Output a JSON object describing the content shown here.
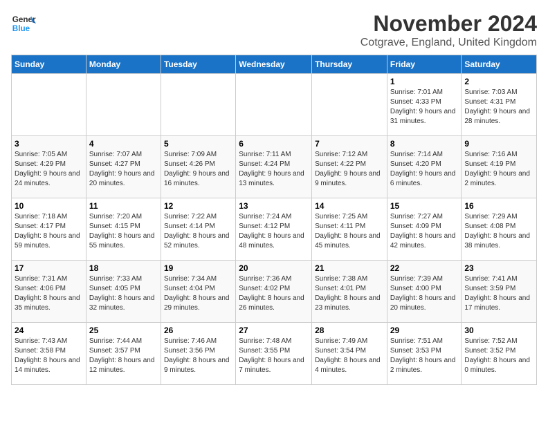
{
  "header": {
    "logo_line1": "General",
    "logo_line2": "Blue",
    "month": "November 2024",
    "location": "Cotgrave, England, United Kingdom"
  },
  "columns": [
    "Sunday",
    "Monday",
    "Tuesday",
    "Wednesday",
    "Thursday",
    "Friday",
    "Saturday"
  ],
  "weeks": [
    [
      {
        "day": "",
        "detail": ""
      },
      {
        "day": "",
        "detail": ""
      },
      {
        "day": "",
        "detail": ""
      },
      {
        "day": "",
        "detail": ""
      },
      {
        "day": "",
        "detail": ""
      },
      {
        "day": "1",
        "detail": "Sunrise: 7:01 AM\nSunset: 4:33 PM\nDaylight: 9 hours and 31 minutes."
      },
      {
        "day": "2",
        "detail": "Sunrise: 7:03 AM\nSunset: 4:31 PM\nDaylight: 9 hours and 28 minutes."
      }
    ],
    [
      {
        "day": "3",
        "detail": "Sunrise: 7:05 AM\nSunset: 4:29 PM\nDaylight: 9 hours and 24 minutes."
      },
      {
        "day": "4",
        "detail": "Sunrise: 7:07 AM\nSunset: 4:27 PM\nDaylight: 9 hours and 20 minutes."
      },
      {
        "day": "5",
        "detail": "Sunrise: 7:09 AM\nSunset: 4:26 PM\nDaylight: 9 hours and 16 minutes."
      },
      {
        "day": "6",
        "detail": "Sunrise: 7:11 AM\nSunset: 4:24 PM\nDaylight: 9 hours and 13 minutes."
      },
      {
        "day": "7",
        "detail": "Sunrise: 7:12 AM\nSunset: 4:22 PM\nDaylight: 9 hours and 9 minutes."
      },
      {
        "day": "8",
        "detail": "Sunrise: 7:14 AM\nSunset: 4:20 PM\nDaylight: 9 hours and 6 minutes."
      },
      {
        "day": "9",
        "detail": "Sunrise: 7:16 AM\nSunset: 4:19 PM\nDaylight: 9 hours and 2 minutes."
      }
    ],
    [
      {
        "day": "10",
        "detail": "Sunrise: 7:18 AM\nSunset: 4:17 PM\nDaylight: 8 hours and 59 minutes."
      },
      {
        "day": "11",
        "detail": "Sunrise: 7:20 AM\nSunset: 4:15 PM\nDaylight: 8 hours and 55 minutes."
      },
      {
        "day": "12",
        "detail": "Sunrise: 7:22 AM\nSunset: 4:14 PM\nDaylight: 8 hours and 52 minutes."
      },
      {
        "day": "13",
        "detail": "Sunrise: 7:24 AM\nSunset: 4:12 PM\nDaylight: 8 hours and 48 minutes."
      },
      {
        "day": "14",
        "detail": "Sunrise: 7:25 AM\nSunset: 4:11 PM\nDaylight: 8 hours and 45 minutes."
      },
      {
        "day": "15",
        "detail": "Sunrise: 7:27 AM\nSunset: 4:09 PM\nDaylight: 8 hours and 42 minutes."
      },
      {
        "day": "16",
        "detail": "Sunrise: 7:29 AM\nSunset: 4:08 PM\nDaylight: 8 hours and 38 minutes."
      }
    ],
    [
      {
        "day": "17",
        "detail": "Sunrise: 7:31 AM\nSunset: 4:06 PM\nDaylight: 8 hours and 35 minutes."
      },
      {
        "day": "18",
        "detail": "Sunrise: 7:33 AM\nSunset: 4:05 PM\nDaylight: 8 hours and 32 minutes."
      },
      {
        "day": "19",
        "detail": "Sunrise: 7:34 AM\nSunset: 4:04 PM\nDaylight: 8 hours and 29 minutes."
      },
      {
        "day": "20",
        "detail": "Sunrise: 7:36 AM\nSunset: 4:02 PM\nDaylight: 8 hours and 26 minutes."
      },
      {
        "day": "21",
        "detail": "Sunrise: 7:38 AM\nSunset: 4:01 PM\nDaylight: 8 hours and 23 minutes."
      },
      {
        "day": "22",
        "detail": "Sunrise: 7:39 AM\nSunset: 4:00 PM\nDaylight: 8 hours and 20 minutes."
      },
      {
        "day": "23",
        "detail": "Sunrise: 7:41 AM\nSunset: 3:59 PM\nDaylight: 8 hours and 17 minutes."
      }
    ],
    [
      {
        "day": "24",
        "detail": "Sunrise: 7:43 AM\nSunset: 3:58 PM\nDaylight: 8 hours and 14 minutes."
      },
      {
        "day": "25",
        "detail": "Sunrise: 7:44 AM\nSunset: 3:57 PM\nDaylight: 8 hours and 12 minutes."
      },
      {
        "day": "26",
        "detail": "Sunrise: 7:46 AM\nSunset: 3:56 PM\nDaylight: 8 hours and 9 minutes."
      },
      {
        "day": "27",
        "detail": "Sunrise: 7:48 AM\nSunset: 3:55 PM\nDaylight: 8 hours and 7 minutes."
      },
      {
        "day": "28",
        "detail": "Sunrise: 7:49 AM\nSunset: 3:54 PM\nDaylight: 8 hours and 4 minutes."
      },
      {
        "day": "29",
        "detail": "Sunrise: 7:51 AM\nSunset: 3:53 PM\nDaylight: 8 hours and 2 minutes."
      },
      {
        "day": "30",
        "detail": "Sunrise: 7:52 AM\nSunset: 3:52 PM\nDaylight: 8 hours and 0 minutes."
      }
    ]
  ]
}
